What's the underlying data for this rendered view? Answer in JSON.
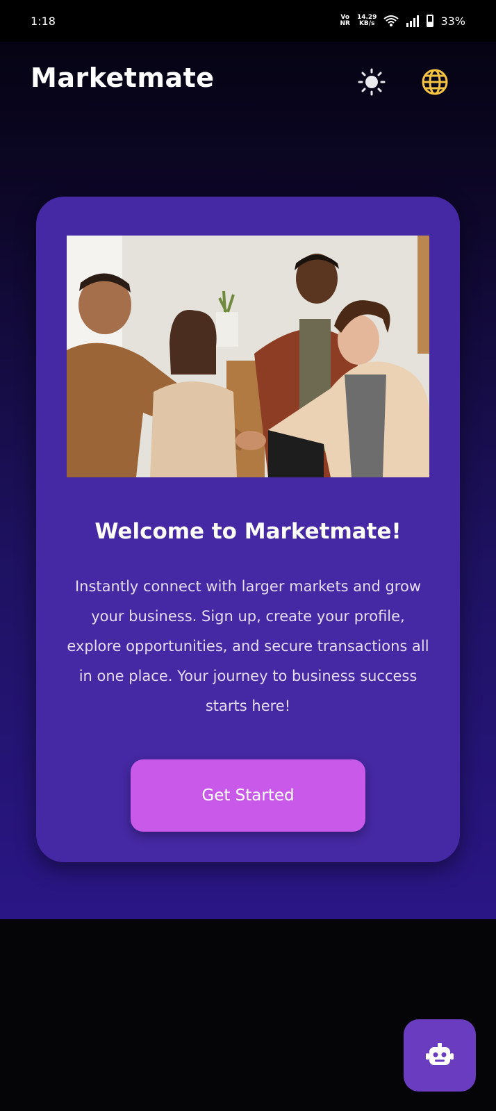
{
  "status": {
    "time": "1:18",
    "net_top": "Vo",
    "net_bottom": "NR",
    "speed_top": "14.29",
    "speed_bottom": "KB/s",
    "battery": "33%"
  },
  "header": {
    "title": "Marketmate",
    "theme_icon": "sun-icon",
    "language_icon": "globe-icon"
  },
  "card": {
    "image_alt": "Business people shaking hands",
    "heading": "Welcome to Marketmate!",
    "description": "Instantly connect with larger markets and grow your business. Sign up, create your profile, explore opportunities, and secure transactions all in one place. Your journey to business success starts here!",
    "cta_label": "Get Started"
  },
  "fab": {
    "icon": "robot-icon"
  },
  "colors": {
    "card": "#4528a3",
    "cta": "#c95ae9",
    "fab": "#6a3cc0",
    "globe": "#f5c542"
  }
}
